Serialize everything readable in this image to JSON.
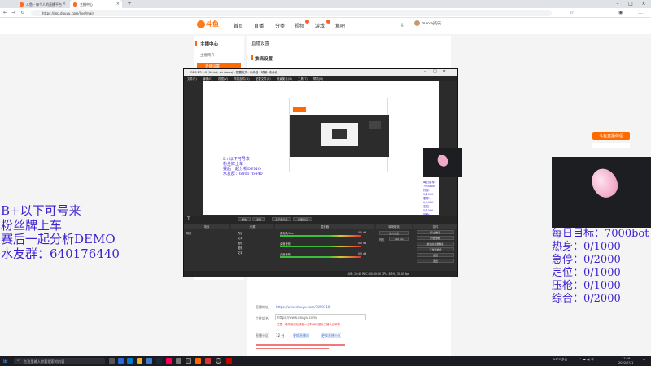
{
  "browser": {
    "tabs": [
      {
        "label": "斗鱼 - 每个人的直播平台"
      },
      {
        "label": "主播中心"
      }
    ],
    "url": "https://mp.douyu.com/live/main",
    "user_name": "maolaj的天..."
  },
  "site": {
    "logo_text": "斗鱼",
    "nav": [
      "首页",
      "直播",
      "分类",
      "视频",
      "游戏",
      "鱼吧"
    ],
    "sidebar_title": "主播中心",
    "sidebar_items": [
      "主播简介",
      "直播设置"
    ],
    "main_title": "直播设置",
    "section_title": "推流设置",
    "push_section": "推流",
    "rows": [
      {
        "label": "直播地址:",
        "value": "https://www.douyu.com/7890318"
      },
      {
        "label": "个性域名:",
        "value": "https://www.douyu.com/"
      },
      {
        "label": "直播分区:",
        "value": "12 分"
      }
    ],
    "links": [
      "更换直播间",
      "更换直播分区"
    ],
    "warning": "注意：修改完成后请在一定时间内进行主播认证审核"
  },
  "obs": {
    "title": "OBS 27.1.3 (64-bit, windows) - 配置文件: 未命名 - 场景: 未命名",
    "menu": [
      "文件(F)",
      "编辑(E)",
      "视图(V)",
      "停靠部件(D)",
      "配置文件(P)",
      "场景集合(S)",
      "工具(T)",
      "帮助(H)"
    ],
    "filter_buttons": [
      "属性",
      "滤镜",
      "显示器采集",
      "截图窗口"
    ],
    "panels": [
      "场景",
      "来源",
      "混音器",
      "转场特效",
      "控件"
    ],
    "scene_item": "场景",
    "sources": [
      "背景",
      "文本",
      "图像",
      "图像",
      "文本"
    ],
    "mixer": [
      {
        "name": "麦克风/Aux",
        "db": "0.0 dB"
      },
      {
        "name": "桌面音频",
        "db": "0.0 dB"
      },
      {
        "name": "桌面音频",
        "db": "0.0 dB"
      }
    ],
    "transition": "淡入淡出",
    "duration_label": "时长",
    "duration": "300 ms",
    "controls": [
      "停止推流",
      "开始录制",
      "启动虚拟摄像机",
      "工作室模式",
      "设置",
      "退出"
    ],
    "status": "LIVE: 12:40   REC: 00:00:00   CPU: 8.5%, 30.00 fps",
    "inner_overlay": [
      "B+以下可号来",
      "粉丝牌上车",
      "赛后一起分析DEMO",
      "水友群：640176440"
    ]
  },
  "overlay": {
    "left_lines": [
      "B+以下可号来",
      "粉丝牌上车",
      "赛后一起分析DEMO",
      "水友群：640176440"
    ],
    "right_lines": [
      "每日目标：7000bot",
      "热身：0/1000",
      "急停：0/2000",
      "定位：0/1000",
      "压枪：0/1000",
      "综合：0/2000"
    ],
    "badge": "斗鱼直播伴侣"
  },
  "taskbar": {
    "search_placeholder": "在这里输入你要搜索的内容",
    "weather": "24°C 多云",
    "time": "17:16",
    "date": "2022/7/11"
  },
  "colors": {
    "accent": "#ff6a00",
    "overlay_text": "#3f1fd0",
    "link": "#3a6fd8"
  }
}
